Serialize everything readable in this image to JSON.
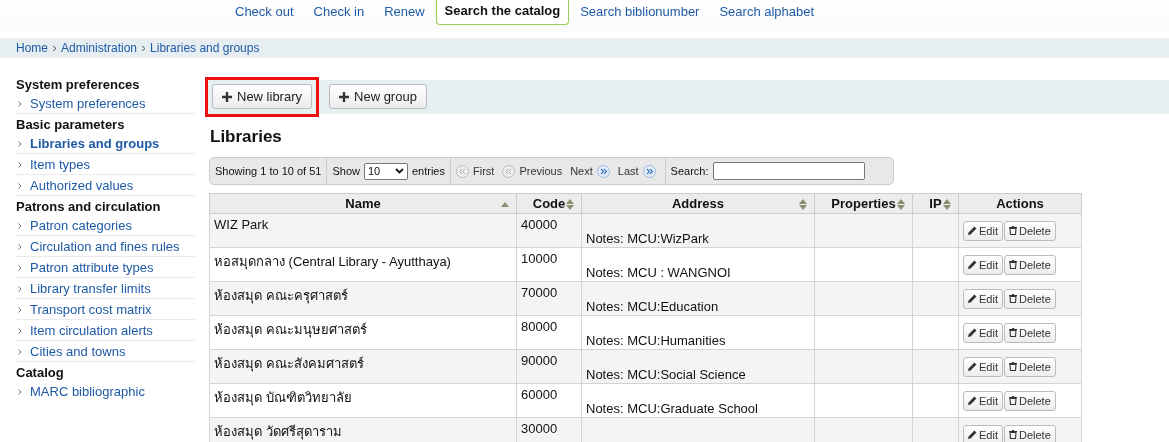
{
  "top_nav": [
    {
      "label": "Check out",
      "selected": false
    },
    {
      "label": "Check in",
      "selected": false
    },
    {
      "label": "Renew",
      "selected": false
    },
    {
      "label": "Search the catalog",
      "selected": true
    },
    {
      "label": "Search biblionumber",
      "selected": false
    },
    {
      "label": "Search alphabet",
      "selected": false
    }
  ],
  "breadcrumb": [
    "Home",
    "Administration",
    "Libraries and groups"
  ],
  "sidebar": [
    {
      "heading": "System preferences",
      "items": [
        {
          "label": "System preferences",
          "selected": false
        }
      ]
    },
    {
      "heading": "Basic parameters",
      "items": [
        {
          "label": "Libraries and groups",
          "selected": true
        },
        {
          "label": "Item types",
          "selected": false
        },
        {
          "label": "Authorized values",
          "selected": false
        }
      ]
    },
    {
      "heading": "Patrons and circulation",
      "items": [
        {
          "label": "Patron categories",
          "selected": false
        },
        {
          "label": "Circulation and fines rules",
          "selected": false
        },
        {
          "label": "Patron attribute types",
          "selected": false
        },
        {
          "label": "Library transfer limits",
          "selected": false
        },
        {
          "label": "Transport cost matrix",
          "selected": false
        },
        {
          "label": "Item circulation alerts",
          "selected": false
        },
        {
          "label": "Cities and towns",
          "selected": false
        }
      ]
    },
    {
      "heading": "Catalog",
      "items": [
        {
          "label": "MARC bibliographic",
          "selected": false
        }
      ]
    }
  ],
  "toolbar": {
    "buttons": [
      {
        "label": "New library",
        "highlighted": true
      },
      {
        "label": "New group",
        "highlighted": false
      }
    ]
  },
  "heading": "Libraries",
  "pager": {
    "info": "Showing 1 to 10 of 51",
    "show_label": "Show",
    "page_size": "10",
    "entries_label": "entries",
    "first": "First",
    "previous": "Previous",
    "next": "Next",
    "last": "Last",
    "search_label": "Search:"
  },
  "table": {
    "columns": [
      {
        "label": "Name",
        "sortable": true,
        "sorted": true
      },
      {
        "label": "Code",
        "sortable": true,
        "sorted": false
      },
      {
        "label": "Address",
        "sortable": true,
        "sorted": false
      },
      {
        "label": "Properties",
        "sortable": true,
        "sorted": false
      },
      {
        "label": "IP",
        "sortable": true,
        "sorted": false
      },
      {
        "label": "Actions",
        "sortable": false
      }
    ],
    "rows": [
      {
        "name": "WIZ Park",
        "code": "40000",
        "notes": "Notes: MCU:WizPark",
        "actions": [
          "Edit",
          "Delete"
        ]
      },
      {
        "name": "หอสมุดกลาง (Central Library - Ayutthaya)",
        "code": "10000",
        "notes": "Notes: MCU : WANGNOI",
        "actions": [
          "Edit",
          "Delete"
        ]
      },
      {
        "name": "ห้องสมุด คณะครุศาสตร์",
        "code": "70000",
        "notes": "Notes: MCU:Education",
        "actions": [
          "Edit",
          "Delete"
        ]
      },
      {
        "name": "ห้องสมุด คณะมนุษยศาสตร์",
        "code": "80000",
        "notes": "Notes: MCU:Humanities",
        "actions": [
          "Edit",
          "Delete"
        ]
      },
      {
        "name": "ห้องสมุด คณะสังคมศาสตร์",
        "code": "90000",
        "notes": "Notes: MCU:Social Science",
        "actions": [
          "Edit",
          "Delete"
        ]
      },
      {
        "name": "ห้องสมุด บัณฑิตวิทยาลัย",
        "code": "60000",
        "notes": "Notes: MCU:Graduate School",
        "actions": [
          "Edit",
          "Delete"
        ]
      },
      {
        "name": "ห้องสมุด วัดศรีสุดาราม",
        "code": "30000",
        "actions": [
          "Edit",
          "Delete"
        ]
      }
    ]
  }
}
